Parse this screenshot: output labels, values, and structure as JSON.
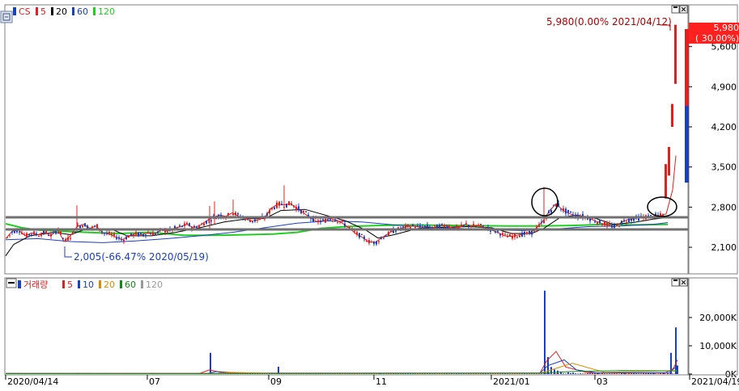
{
  "icon": "chart-settings-icon",
  "price_panel": {
    "legend_prefix": "CS",
    "legend": [
      {
        "label": "5",
        "color": "#e02020"
      },
      {
        "label": "20",
        "color": "#000000"
      },
      {
        "label": "60",
        "color": "#1a3fbf"
      },
      {
        "label": "120",
        "color": "#22cc22"
      }
    ],
    "last_label": "5,980(0.00% 2021/04/12)",
    "current_price": "5,980",
    "current_change": "( 30.00%)",
    "low_label": "2,005(-66.47% 2020/05/19)",
    "colors": {
      "up": "#e02020",
      "down": "#1a3fbf",
      "label": "#b00000"
    }
  },
  "volume_panel": {
    "legend_prefix": "거래량",
    "legend": [
      {
        "label": "5",
        "color": "#e02020"
      },
      {
        "label": "10",
        "color": "#1a3fbf"
      },
      {
        "label": "20",
        "color": "#d98c00"
      },
      {
        "label": "60",
        "color": "#138a13"
      },
      {
        "label": "120",
        "color": "#999999"
      }
    ]
  },
  "chart_data": [
    {
      "type": "candlestick",
      "title": "",
      "x": [
        "2020/04/14",
        "07",
        "09",
        "11",
        "2021/01",
        "03",
        "2021/04/19"
      ],
      "y_ticks": [
        "2,100",
        "2,800",
        "3,500",
        "4,200",
        "4,900",
        "5,600"
      ],
      "ylim": [
        1650,
        6300
      ],
      "series": [
        {
          "name": "5",
          "points": [
            [
              0,
              2250
            ],
            [
              8,
              2380
            ],
            [
              16,
              2400
            ],
            [
              24,
              2300
            ],
            [
              32,
              2350
            ],
            [
              40,
              2320
            ],
            [
              48,
              2360
            ],
            [
              56,
              2300
            ],
            [
              64,
              2420
            ],
            [
              72,
              2200
            ],
            [
              80,
              2300
            ],
            [
              88,
              2460
            ],
            [
              96,
              2500
            ],
            [
              104,
              2430
            ],
            [
              112,
              2470
            ],
            [
              120,
              2350
            ],
            [
              128,
              2330
            ],
            [
              136,
              2280
            ],
            [
              144,
              2230
            ],
            [
              152,
              2300
            ],
            [
              160,
              2330
            ],
            [
              168,
              2320
            ],
            [
              176,
              2350
            ],
            [
              184,
              2330
            ],
            [
              192,
              2400
            ],
            [
              200,
              2380
            ],
            [
              208,
              2430
            ],
            [
              216,
              2460
            ],
            [
              224,
              2500
            ],
            [
              232,
              2440
            ],
            [
              240,
              2480
            ],
            [
              248,
              2560
            ],
            [
              256,
              2620
            ],
            [
              264,
              2660
            ],
            [
              272,
              2640
            ],
            [
              280,
              2700
            ],
            [
              288,
              2640
            ],
            [
              296,
              2600
            ],
            [
              304,
              2560
            ],
            [
              312,
              2580
            ],
            [
              320,
              2620
            ],
            [
              328,
              2780
            ],
            [
              336,
              2850
            ],
            [
              344,
              2840
            ],
            [
              352,
              2860
            ],
            [
              360,
              2780
            ],
            [
              368,
              2700
            ],
            [
              376,
              2620
            ],
            [
              384,
              2550
            ],
            [
              392,
              2560
            ],
            [
              400,
              2600
            ],
            [
              408,
              2580
            ],
            [
              416,
              2520
            ],
            [
              424,
              2440
            ],
            [
              432,
              2340
            ],
            [
              440,
              2280
            ],
            [
              448,
              2200
            ],
            [
              456,
              2180
            ],
            [
              464,
              2260
            ],
            [
              472,
              2330
            ],
            [
              480,
              2400
            ],
            [
              488,
              2430
            ],
            [
              496,
              2460
            ],
            [
              504,
              2470
            ],
            [
              512,
              2450
            ],
            [
              520,
              2460
            ],
            [
              528,
              2440
            ],
            [
              536,
              2470
            ],
            [
              544,
              2480
            ],
            [
              552,
              2440
            ],
            [
              560,
              2440
            ],
            [
              568,
              2500
            ],
            [
              576,
              2470
            ],
            [
              584,
              2480
            ],
            [
              592,
              2440
            ],
            [
              600,
              2400
            ],
            [
              608,
              2360
            ],
            [
              616,
              2300
            ],
            [
              624,
              2290
            ],
            [
              632,
              2310
            ],
            [
              640,
              2330
            ],
            [
              648,
              2350
            ],
            [
              656,
              2440
            ],
            [
              664,
              2560
            ],
            [
              672,
              2740
            ],
            [
              680,
              2860
            ],
            [
              688,
              2750
            ],
            [
              696,
              2690
            ],
            [
              704,
              2650
            ],
            [
              712,
              2640
            ],
            [
              720,
              2610
            ],
            [
              728,
              2560
            ],
            [
              736,
              2520
            ],
            [
              744,
              2490
            ],
            [
              752,
              2450
            ],
            [
              760,
              2530
            ],
            [
              768,
              2580
            ],
            [
              776,
              2600
            ],
            [
              784,
              2620
            ],
            [
              792,
              2630
            ],
            [
              800,
              2640
            ],
            [
              808,
              2650
            ],
            [
              816,
              2680
            ],
            [
              824,
              3100
            ],
            [
              828,
              3700
            ]
          ]
        },
        {
          "name": "20",
          "points": [
            [
              0,
              1950
            ],
            [
              10,
              2150
            ],
            [
              30,
              2300
            ],
            [
              60,
              2360
            ],
            [
              80,
              2320
            ],
            [
              100,
              2420
            ],
            [
              130,
              2420
            ],
            [
              150,
              2300
            ],
            [
              180,
              2300
            ],
            [
              210,
              2360
            ],
            [
              240,
              2440
            ],
            [
              270,
              2540
            ],
            [
              300,
              2600
            ],
            [
              320,
              2600
            ],
            [
              340,
              2740
            ],
            [
              370,
              2760
            ],
            [
              395,
              2660
            ],
            [
              420,
              2560
            ],
            [
              445,
              2400
            ],
            [
              460,
              2260
            ],
            [
              480,
              2320
            ],
            [
              510,
              2430
            ],
            [
              540,
              2450
            ],
            [
              570,
              2460
            ],
            [
              600,
              2440
            ],
            [
              625,
              2340
            ],
            [
              650,
              2340
            ],
            [
              665,
              2430
            ],
            [
              685,
              2620
            ],
            [
              705,
              2660
            ],
            [
              730,
              2600
            ],
            [
              750,
              2500
            ],
            [
              775,
              2530
            ],
            [
              800,
              2590
            ],
            [
              818,
              2620
            ]
          ]
        },
        {
          "name": "60",
          "points": [
            [
              0,
              2230
            ],
            [
              40,
              2250
            ],
            [
              80,
              2200
            ],
            [
              120,
              2180
            ],
            [
              160,
              2210
            ],
            [
              200,
              2250
            ],
            [
              240,
              2300
            ],
            [
              280,
              2360
            ],
            [
              320,
              2440
            ],
            [
              360,
              2520
            ],
            [
              400,
              2560
            ],
            [
              440,
              2540
            ],
            [
              480,
              2490
            ],
            [
              520,
              2450
            ],
            [
              560,
              2430
            ],
            [
              600,
              2400
            ],
            [
              640,
              2390
            ],
            [
              680,
              2420
            ],
            [
              720,
              2460
            ],
            [
              760,
              2470
            ],
            [
              800,
              2500
            ],
            [
              818,
              2530
            ]
          ]
        },
        {
          "name": "120",
          "points": [
            [
              0,
              2510
            ],
            [
              20,
              2440
            ],
            [
              40,
              2400
            ],
            [
              70,
              2380
            ],
            [
              100,
              2360
            ],
            [
              140,
              2340
            ],
            [
              180,
              2360
            ],
            [
              220,
              2310
            ],
            [
              260,
              2310
            ],
            [
              300,
              2320
            ],
            [
              330,
              2330
            ],
            [
              360,
              2360
            ],
            [
              390,
              2430
            ],
            [
              420,
              2460
            ],
            [
              460,
              2480
            ],
            [
              500,
              2490
            ],
            [
              560,
              2480
            ],
            [
              620,
              2470
            ],
            [
              660,
              2470
            ],
            [
              700,
              2480
            ],
            [
              740,
              2500
            ],
            [
              780,
              2490
            ],
            [
              818,
              2500
            ]
          ]
        }
      ]
    },
    {
      "type": "bar",
      "title": "",
      "y_ticks": [
        "0K",
        "10,000K",
        "20,000K"
      ],
      "ylim": [
        0,
        30000
      ],
      "series": [
        {
          "name": "거래량",
          "values": [
            [
              88,
              400
            ],
            [
              180,
              350
            ],
            [
              252,
              7500
            ],
            [
              336,
              2600
            ],
            [
              461,
              400
            ],
            [
              665,
              29500
            ],
            [
              669,
              6000
            ],
            [
              673,
              2500
            ],
            [
              677,
              1600
            ],
            [
              681,
              1200
            ],
            [
              685,
              900
            ],
            [
              694,
              600
            ],
            [
              700,
              500
            ],
            [
              731,
              400
            ],
            [
              764,
              300
            ],
            [
              800,
              200
            ],
            [
              812,
              300
            ],
            [
              821,
              7500
            ],
            [
              827,
              16500
            ],
            [
              829,
              3000
            ]
          ]
        }
      ]
    }
  ]
}
